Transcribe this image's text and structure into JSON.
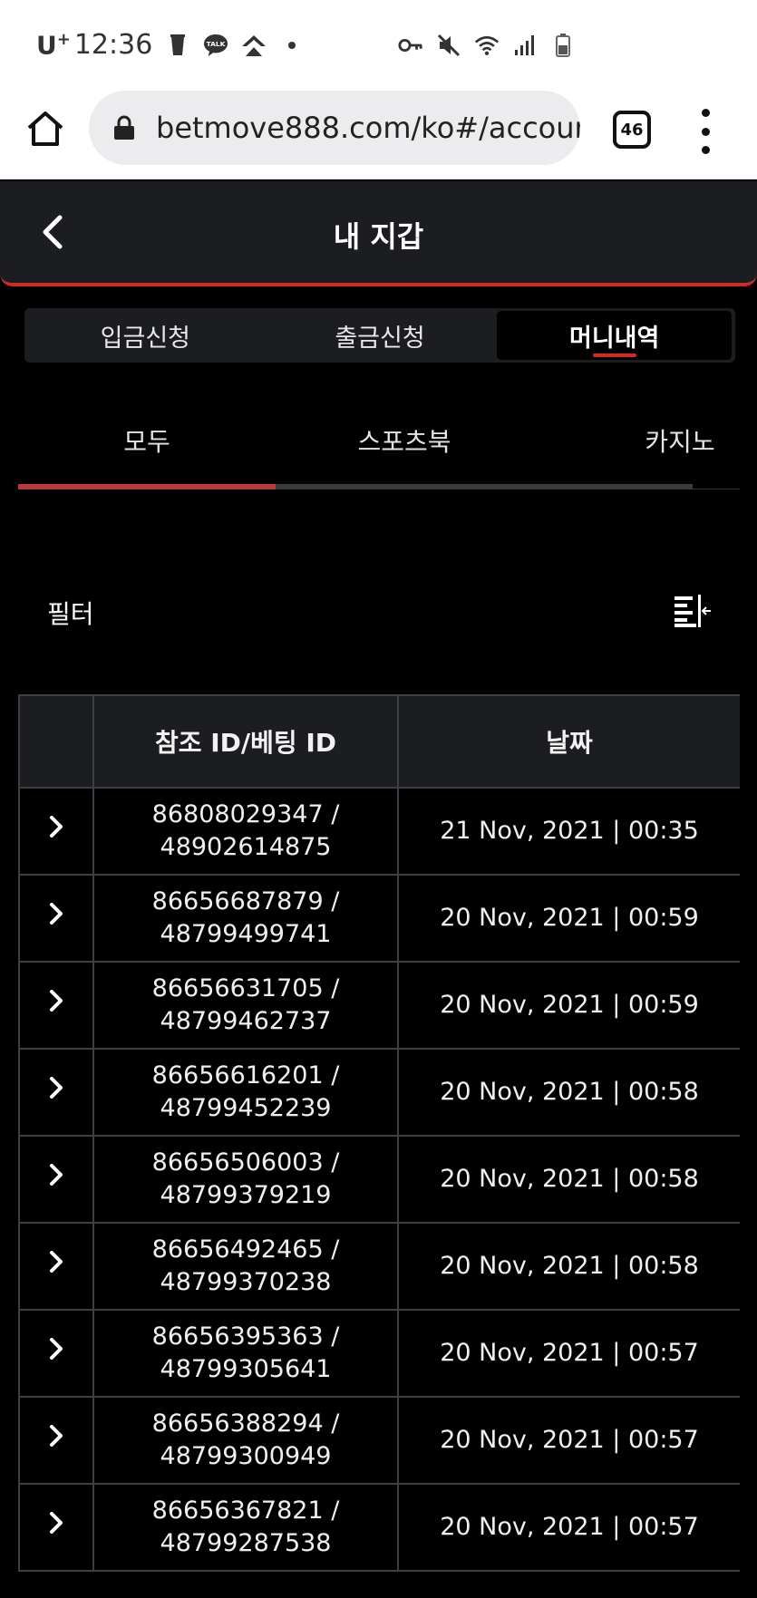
{
  "status_bar": {
    "carrier": "U",
    "carrier_sup": "+",
    "time": "12:36",
    "talk_label": "TALK"
  },
  "browser": {
    "url": "betmove888.com/ko#/accour",
    "tab_count": "46"
  },
  "header": {
    "title": "내 지갑"
  },
  "segments": [
    {
      "label": "입금신청",
      "active": false
    },
    {
      "label": "출금신청",
      "active": false
    },
    {
      "label": "머니내역",
      "active": true
    }
  ],
  "subtabs": [
    {
      "label": "모두",
      "active": true
    },
    {
      "label": "스포츠북",
      "active": false
    },
    {
      "label": "카지노",
      "active": false
    }
  ],
  "filter": {
    "label": "필터"
  },
  "table": {
    "headers": [
      "",
      "참조 ID/베팅 ID",
      "날짜"
    ],
    "rows": [
      {
        "ref": "86808029347 /",
        "bet": "48902614875",
        "date": "21 Nov, 2021 | 00:35"
      },
      {
        "ref": "86656687879 /",
        "bet": "48799499741",
        "date": "20 Nov, 2021 | 00:59"
      },
      {
        "ref": "86656631705 /",
        "bet": "48799462737",
        "date": "20 Nov, 2021 | 00:59"
      },
      {
        "ref": "86656616201 /",
        "bet": "48799452239",
        "date": "20 Nov, 2021 | 00:58"
      },
      {
        "ref": "86656506003 /",
        "bet": "48799379219",
        "date": "20 Nov, 2021 | 00:58"
      },
      {
        "ref": "86656492465 /",
        "bet": "48799370238",
        "date": "20 Nov, 2021 | 00:58"
      },
      {
        "ref": "86656395363 /",
        "bet": "48799305641",
        "date": "20 Nov, 2021 | 00:57"
      },
      {
        "ref": "86656388294 /",
        "bet": "48799300949",
        "date": "20 Nov, 2021 | 00:57"
      },
      {
        "ref": "86656367821 /",
        "bet": "48799287538",
        "date": "20 Nov, 2021 | 00:57"
      }
    ]
  },
  "colors": {
    "accent": "#d32a28",
    "panel": "#1c1d21",
    "background": "#000000",
    "grid": "#3e3f44"
  },
  "icons": {
    "back": "chevron-left-icon",
    "row_expand": "chevron-right-icon",
    "filter": "filter-collapse-icon",
    "home": "home-icon",
    "lock": "lock-icon",
    "menu": "more-vert-icon"
  }
}
